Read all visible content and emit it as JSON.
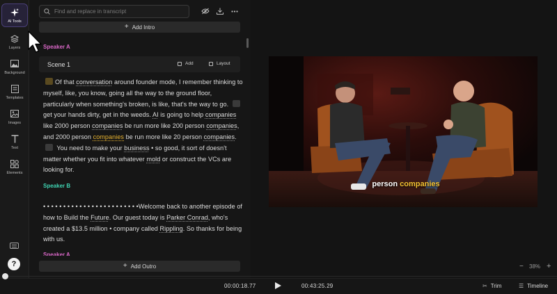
{
  "sidebar": {
    "items": [
      {
        "label": "AI Tools",
        "icon": "sparkles-icon"
      },
      {
        "label": "Layers",
        "icon": "layers-icon"
      },
      {
        "label": "Background",
        "icon": "image-icon"
      },
      {
        "label": "Templates",
        "icon": "template-icon"
      },
      {
        "label": "Images",
        "icon": "image-icon"
      },
      {
        "label": "Text",
        "icon": "text-icon"
      },
      {
        "label": "Elements",
        "icon": "shapes-icon"
      }
    ],
    "help_label": "?"
  },
  "transcript": {
    "search_placeholder": "Find and replace in transcript",
    "add_intro": "Add Intro",
    "add_outro": "Add Outro",
    "speaker_a": "Speaker A",
    "speaker_b": "Speaker B",
    "scene": {
      "title": "Scene 1",
      "add": "Add",
      "layout": "Layout"
    },
    "para1": [
      "Of that ",
      "conversation",
      " around founder mode, I remember thinking to myself, like, you know, going all the way to the ground floor, particularly when something's broken, is like, that's the way to go.",
      "get your hands dirty, get in the weeds. ",
      "AI",
      " is going to help ",
      "companies",
      " like 2000 person ",
      "companies",
      " be run more like 200 person ",
      "companies",
      ", and 2000 person ",
      "companies",
      " be run more like 20 person ",
      "companies",
      ".",
      "You need to make your ",
      "business",
      " • so good, it sort of doesn't matter whether you fit into whatever ",
      "mold",
      " or construct the VCs are looking for."
    ],
    "para2": [
      "• • • • • • • • • • • • • • • • • • • • • • • •Welcome back to another episode of how to Build the ",
      "Future",
      ". Our guest today is ",
      "Parker Conrad",
      ", who's created a $13.5 million • company called ",
      "Rippling",
      ". So thanks for being with us."
    ]
  },
  "preview": {
    "caption_plain": "person",
    "caption_keyword": "companies",
    "zoom": "38%",
    "accent": "#f5c232"
  },
  "playback": {
    "current": "00:00:18.77",
    "total": "00:43:25.29",
    "trim": "Trim",
    "timeline": "Timeline"
  }
}
